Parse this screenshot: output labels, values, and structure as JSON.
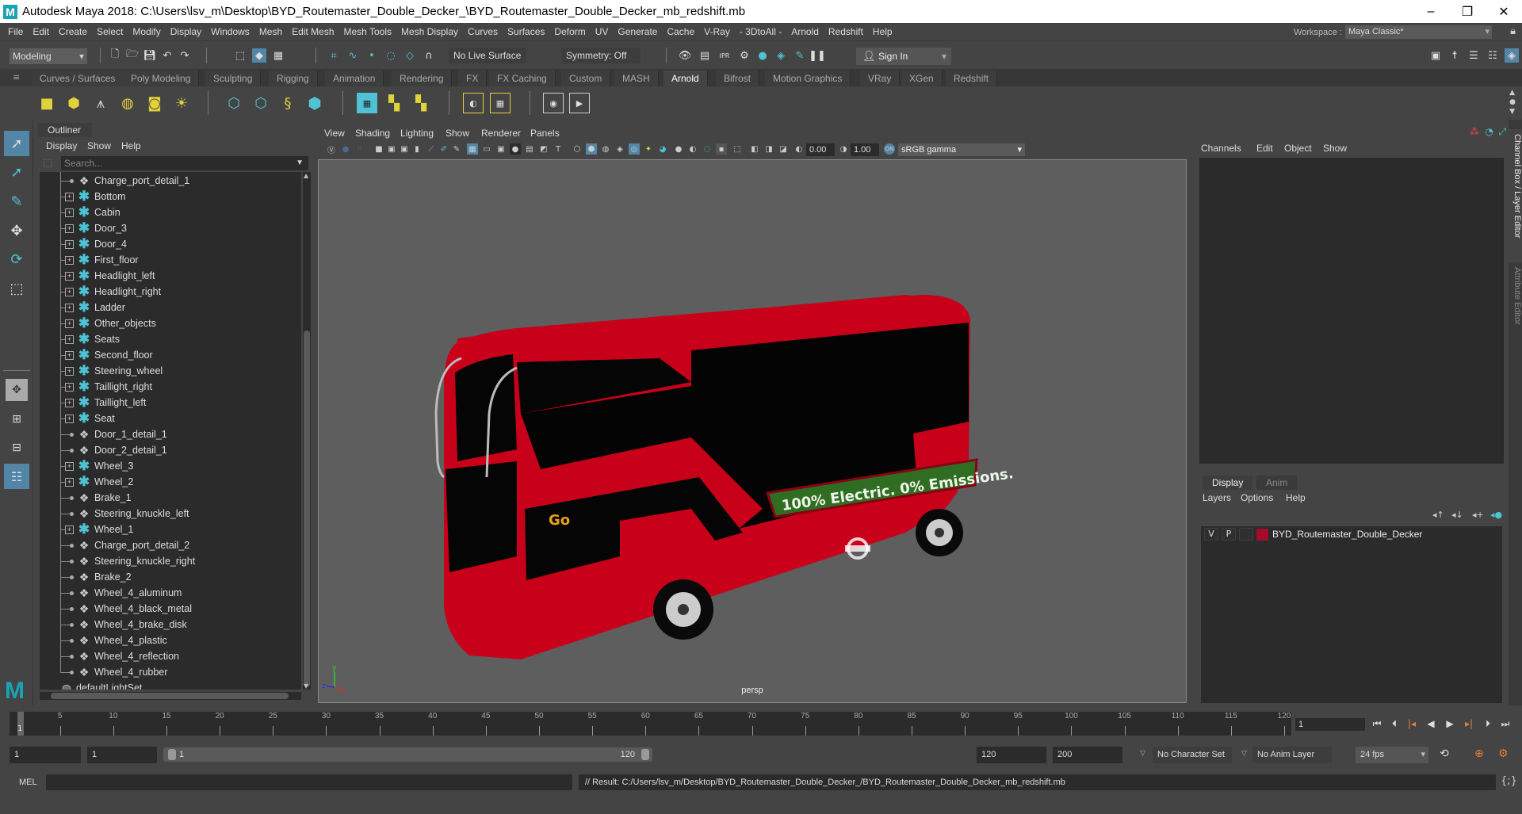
{
  "window": {
    "app_icon": "maya-logo-icon",
    "title": "Autodesk Maya 2018: C:\\Users\\lsv_m\\Desktop\\BYD_Routemaster_Double_Decker_\\BYD_Routemaster_Double_Decker_mb_redshift.mb",
    "controls": {
      "minimize": "–",
      "maximize": "❐",
      "close": "✕"
    }
  },
  "menubar": {
    "items": [
      "File",
      "Edit",
      "Create",
      "Select",
      "Modify",
      "Display",
      "Windows",
      "Mesh",
      "Edit Mesh",
      "Mesh Tools",
      "Mesh Display",
      "Curves",
      "Surfaces",
      "Deform",
      "UV",
      "Generate",
      "Cache",
      "V-Ray",
      "- 3DtoAll -",
      "Arnold",
      "Redshift",
      "Help"
    ],
    "workspace_label": "Workspace :",
    "workspace_value": "Maya Classic*"
  },
  "statusline": {
    "mode": "Modeling",
    "live_surface": "No Live Surface",
    "symmetry": "Symmetry: Off",
    "sign_in": "Sign In"
  },
  "shelf": {
    "tabs": [
      "Curves / Surfaces",
      "Poly Modeling",
      "Sculpting",
      "Rigging",
      "Animation",
      "Rendering",
      "FX",
      "FX Caching",
      "Custom",
      "MASH",
      "Arnold",
      "Bifrost",
      "Motion Graphics",
      "VRay",
      "XGen",
      "Redshift"
    ],
    "active_tab": "Arnold",
    "icons": [
      "area-light-icon",
      "mesh-light-icon",
      "photometric-light-icon",
      "skydome-light-icon",
      "light-portal-icon",
      "physical-sky-icon",
      "standin-create-icon",
      "standin-export-icon",
      "curve-collector-icon",
      "volume-icon",
      "render-view-icon",
      "tx-manager-icon",
      "flush-textures-icon",
      "shader-assign-icon",
      "texture-assign-icon",
      "ipr-icon",
      "render-icon"
    ]
  },
  "outliner": {
    "title": "Outliner",
    "menu": [
      "Display",
      "Show",
      "Help"
    ],
    "search_placeholder": "Search...",
    "items": [
      {
        "name": "Charge_port_detail_1",
        "type": "mesh"
      },
      {
        "name": "Bottom",
        "type": "group"
      },
      {
        "name": "Cabin",
        "type": "group"
      },
      {
        "name": "Door_3",
        "type": "group"
      },
      {
        "name": "Door_4",
        "type": "group"
      },
      {
        "name": "First_floor",
        "type": "group"
      },
      {
        "name": "Headlight_left",
        "type": "group"
      },
      {
        "name": "Headlight_right",
        "type": "group"
      },
      {
        "name": "Ladder",
        "type": "group"
      },
      {
        "name": "Other_objects",
        "type": "group"
      },
      {
        "name": "Seats",
        "type": "group"
      },
      {
        "name": "Second_floor",
        "type": "group"
      },
      {
        "name": "Steering_wheel",
        "type": "group"
      },
      {
        "name": "Taillight_right",
        "type": "group"
      },
      {
        "name": "Taillight_left",
        "type": "group"
      },
      {
        "name": "Seat",
        "type": "group"
      },
      {
        "name": "Door_1_detail_1",
        "type": "mesh"
      },
      {
        "name": "Door_2_detail_1",
        "type": "mesh"
      },
      {
        "name": "Wheel_3",
        "type": "group"
      },
      {
        "name": "Wheel_2",
        "type": "group"
      },
      {
        "name": "Brake_1",
        "type": "mesh"
      },
      {
        "name": "Steering_knuckle_left",
        "type": "mesh"
      },
      {
        "name": "Wheel_1",
        "type": "group"
      },
      {
        "name": "Charge_port_detail_2",
        "type": "mesh"
      },
      {
        "name": "Steering_knuckle_right",
        "type": "mesh"
      },
      {
        "name": "Brake_2",
        "type": "mesh"
      },
      {
        "name": "Wheel_4_aluminum",
        "type": "mesh"
      },
      {
        "name": "Wheel_4_black_metal",
        "type": "mesh"
      },
      {
        "name": "Wheel_4_brake_disk",
        "type": "mesh"
      },
      {
        "name": "Wheel_4_plastic",
        "type": "mesh"
      },
      {
        "name": "Wheel_4_reflection",
        "type": "mesh"
      },
      {
        "name": "Wheel_4_rubber",
        "type": "mesh"
      },
      {
        "name": "defaultLightSet",
        "type": "set"
      }
    ]
  },
  "viewport": {
    "menu": [
      "View",
      "Shading",
      "Lighting",
      "Show",
      "Renderer",
      "Panels"
    ],
    "exposure": "0.00",
    "gamma": "1.00",
    "color_space": "sRGB gamma",
    "camera": "persp",
    "axis": {
      "x": "x",
      "y": "y",
      "z": "z"
    },
    "scene": {
      "object": "BYD Routemaster Double Decker bus",
      "ad_text": "100% Electric. 0% Emissions.",
      "body_color": "#c8001a"
    }
  },
  "channelbox": {
    "menu": [
      "Channels",
      "Edit",
      "Object",
      "Show"
    ]
  },
  "layer_editor": {
    "tabs": [
      "Display",
      "Anim"
    ],
    "active_tab": "Display",
    "menu": [
      "Layers",
      "Options",
      "Help"
    ],
    "layers": [
      {
        "visible": "V",
        "playback": "P",
        "color": "#a50b2b",
        "name": "BYD_Routemaster_Double_Decker"
      }
    ]
  },
  "side_tabs": [
    "Channel Box / Layer Editor",
    "Attribute Editor"
  ],
  "timeslider": {
    "ticks": [
      5,
      10,
      15,
      20,
      25,
      30,
      35,
      40,
      45,
      50,
      55,
      60,
      65,
      70,
      75,
      80,
      85,
      90,
      95,
      100,
      105,
      110,
      115,
      120
    ],
    "start": 1,
    "end": 120,
    "current_frame": "1",
    "current_frame_field": "1"
  },
  "range": {
    "start_time": "1",
    "playback_start": "1",
    "range_start_label": "1",
    "range_end_label": "120",
    "playback_end": "120",
    "end_time": "200",
    "character_set": "No Character Set",
    "anim_layer": "No Anim Layer",
    "fps": "24 fps"
  },
  "commandline": {
    "label": "MEL",
    "result": "// Result: C:/Users/lsv_m/Desktop/BYD_Routemaster_Double_Decker_/BYD_Routemaster_Double_Decker_mb_redshift.mb"
  }
}
